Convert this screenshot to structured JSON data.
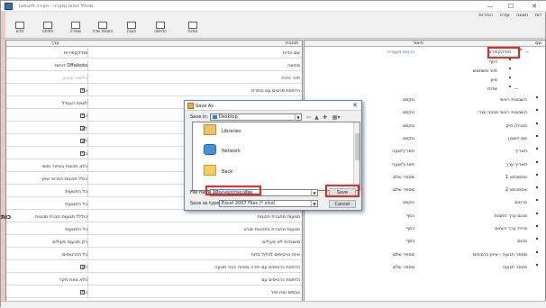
{
  "window": {
    "title": "מחולל דוחות (מקרה - חקירה לדוגמא)",
    "minimize": "—",
    "maximize": "☐",
    "close": "✕"
  },
  "menu": [
    "דוח",
    "תצוגה",
    "עזרה",
    "הגדרות"
  ],
  "toolbar": [
    {
      "label": "אודות",
      "icon": "about-icon"
    },
    {
      "label": "הדפסה",
      "icon": "print-icon"
    },
    {
      "label": "הצגה",
      "icon": "preview-icon"
    },
    {
      "label": "הוספת שדה",
      "icon": "add-field-icon"
    },
    {
      "label": "שמירה",
      "icon": "save-icon"
    },
    {
      "label": "פתיחה",
      "icon": "open-icon"
    },
    {
      "label": "חדש",
      "icon": "new-icon"
    }
  ],
  "left_panel": {
    "headers": {
      "property": "תכונות",
      "value": "ערך"
    },
    "rows": [
      {
        "key": "שם הדוח",
        "value": "סודקקפירות",
        "style": ""
      },
      {
        "key": "מחיצה",
        "value": "Offaikota דוחות",
        "style": ""
      },
      {
        "key": "תיור הדוח",
        "value": "כלשהו עשבון",
        "style": "gray"
      },
      {
        "key": "הדפסת פרטים עם כותרת",
        "value": "כן",
        "check": "on"
      },
      {
        "key": "",
        "value": "לצאת הגנודל",
        "style": ""
      },
      {
        "key": "",
        "value": "כן",
        "check": "on"
      },
      {
        "key": "",
        "value": "לא",
        "check": "off"
      },
      {
        "key": "",
        "value": "לא",
        "check": "off"
      },
      {
        "key": "",
        "value": "כן",
        "check": "on"
      },
      {
        "key": "",
        "value": "כלא תכונות באיזור ומשי",
        "style": ""
      },
      {
        "key": "",
        "value": "כולל תכונות הפרטי שוקי",
        "style": ""
      },
      {
        "key": "",
        "value": "כל התנועות",
        "style": ""
      },
      {
        "key": "",
        "value": "כל התנועות",
        "style": ""
      },
      {
        "key": "תנועות מחברת תכונות",
        "value": "כוללל תנועות חברת תכונות",
        "style": ""
      },
      {
        "key": "תנועות מחברת בתכונות שורט",
        "value": "כל התנועות",
        "style": ""
      },
      {
        "key": "משנודות לא פעילים",
        "value": "רק תנועות פעילים",
        "style": ""
      },
      {
        "key": "איזה כרטיסים לכלול בדוח",
        "value": "כל הכרטיסים",
        "style": ""
      },
      {
        "key": "הדפסת כרטיסים עם יתרה מאיזה כבכי תנועה",
        "value": "לא",
        "check": "off"
      },
      {
        "key": "הדפסת כרטיסים עם",
        "value": "כלא צאת תקר",
        "style": ""
      },
      {
        "key": "בבסיס ומח סזר",
        "value": "כן",
        "check": "on"
      }
    ],
    "side_label": "כות"
  },
  "tree_panel": {
    "headers": {
      "col1": "שם",
      "col2": "תיאור"
    },
    "root": {
      "label": "סודקקפירות",
      "desc": "כרטיס מעבדה"
    },
    "nodes": [
      {
        "label": "דחף",
        "indent": 1
      },
      {
        "label": "תיור משתמש",
        "indent": 1
      },
      {
        "label": "מיון",
        "indent": 1
      },
      {
        "label": "שדות",
        "indent": 1,
        "folder": true
      }
    ],
    "fields": [
      {
        "label": "השבונות ראשי",
        "desc": "טקסט"
      },
      {
        "label": "השבונות ראשי סבבב ונגרי",
        "desc": "טקסט"
      },
      {
        "label": "חברה/ תיק",
        "desc": "טקסט"
      },
      {
        "label": "שם השבון",
        "desc": "טקסט"
      },
      {
        "label": "תאריך",
        "desc": "תאריך/שעה"
      },
      {
        "label": "תאריך ערך",
        "desc": "תאריך/שעה"
      },
      {
        "label": "אסמכתא 1",
        "desc": "מספר שלם"
      },
      {
        "label": "אסמכתא 2",
        "desc": "מספר שלם"
      },
      {
        "label": "פרטים",
        "desc": "טקסט"
      },
      {
        "label": "סכום ערך חתבות",
        "desc": "כסף"
      },
      {
        "label": "מרכז ערך רווחים",
        "desc": "כסף"
      },
      {
        "label": "סכום",
        "desc": "כסף"
      },
      {
        "label": "מספר תנועה - איזון כרטיסים",
        "desc": "מספר שלם"
      },
      {
        "label": "מספר תנועה",
        "desc": "מספר שלם"
      }
    ]
  },
  "dialog": {
    "title": "Save As",
    "close": "✕",
    "save_in_label": "Save in:",
    "save_in_value": "Desktop",
    "items": [
      "Libraries",
      "Network",
      "Back"
    ],
    "file_name_label": "File name:",
    "file_name_value": "סודקקפירות10.xlsx",
    "save_type_label": "Save as type:",
    "save_type_value": "Excel 2007 Files (*.xlsx)",
    "save_button": "Save",
    "cancel_button": "Cancel"
  },
  "colors": {
    "highlight": "#e02020",
    "link_blue": "#2a5db0",
    "folder": "#e8c34a"
  }
}
